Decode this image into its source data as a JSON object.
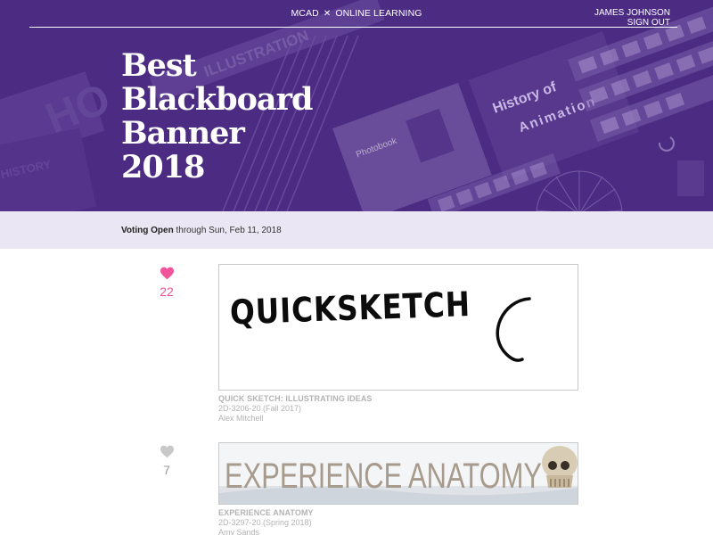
{
  "header": {
    "site_prefix": "MCAD",
    "site_suffix": "ONLINE LEARNING",
    "user_name": "JAMES JOHNSON",
    "sign_out": "SIGN OUT",
    "title_lines": [
      "Best",
      "Blackboard",
      "Banner",
      "2018"
    ],
    "collage": {
      "text_top_left": "HO",
      "text_illustration": "ILLUSTRATION",
      "text_history": "HISTORY",
      "text_photobook": "Photobook",
      "text_history_of": "History of",
      "text_animation": "Animation"
    },
    "colors": {
      "hero_bg": "#4b2c82",
      "text": "#ffffff"
    }
  },
  "voting": {
    "status": "Voting Open",
    "detail": "through Sun, Feb 11, 2018",
    "strip_color": "#ebe6f3"
  },
  "entries": [
    {
      "votes": "22",
      "liked": true,
      "heart_icon": "heart-filled-icon",
      "heart_color": "#f0549a",
      "banner_text": "QUICKSKETCH",
      "course_title": "QUICK SKETCH: ILLUSTRATING IDEAS",
      "course_code": "2D-3206-20 (Fall 2017)",
      "instructor": "Alex Mitchell"
    },
    {
      "votes": "7",
      "liked": false,
      "heart_icon": "heart-outline-icon",
      "heart_color": "#c8c8c8",
      "banner_text": "EXPERIENCE ANATOMY",
      "course_title": "EXPERIENCE ANATOMY",
      "course_code": "2D-3297-20 (Spring 2018)",
      "instructor": "Amy Sands"
    }
  ]
}
